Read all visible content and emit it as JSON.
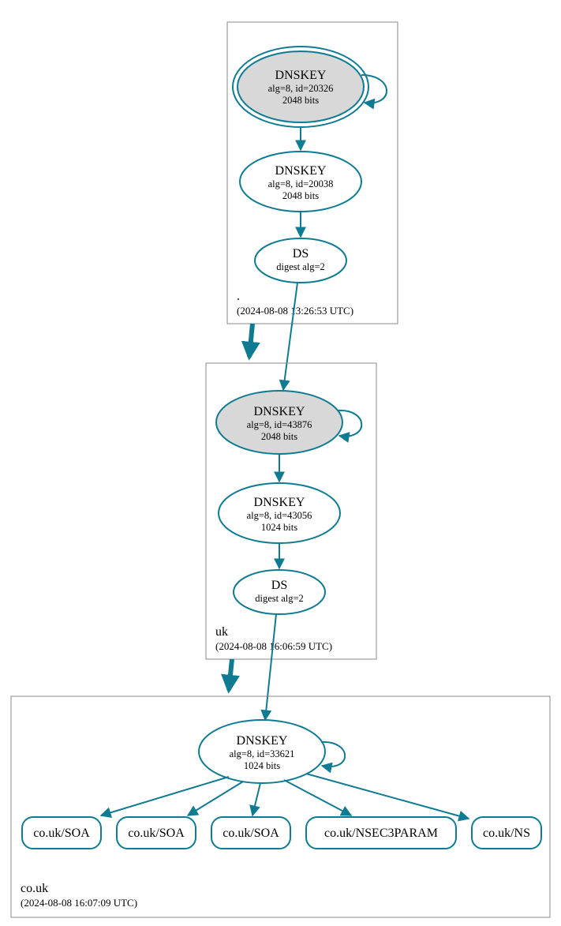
{
  "zones": {
    "root": {
      "name": ".",
      "timestamp": "(2024-08-08 13:26:53 UTC)",
      "dnskey1": {
        "title": "DNSKEY",
        "line1": "alg=8, id=20326",
        "line2": "2048 bits"
      },
      "dnskey2": {
        "title": "DNSKEY",
        "line1": "alg=8, id=20038",
        "line2": "2048 bits"
      },
      "ds": {
        "title": "DS",
        "line1": "digest alg=2"
      }
    },
    "uk": {
      "name": "uk",
      "timestamp": "(2024-08-08 16:06:59 UTC)",
      "dnskey1": {
        "title": "DNSKEY",
        "line1": "alg=8, id=43876",
        "line2": "2048 bits"
      },
      "dnskey2": {
        "title": "DNSKEY",
        "line1": "alg=8, id=43056",
        "line2": "1024 bits"
      },
      "ds": {
        "title": "DS",
        "line1": "digest alg=2"
      }
    },
    "couk": {
      "name": "co.uk",
      "timestamp": "(2024-08-08 16:07:09 UTC)",
      "dnskey1": {
        "title": "DNSKEY",
        "line1": "alg=8, id=33621",
        "line2": "1024 bits"
      },
      "rr1": "co.uk/SOA",
      "rr2": "co.uk/SOA",
      "rr3": "co.uk/SOA",
      "rr4": "co.uk/NSEC3PARAM",
      "rr5": "co.uk/NS"
    }
  }
}
